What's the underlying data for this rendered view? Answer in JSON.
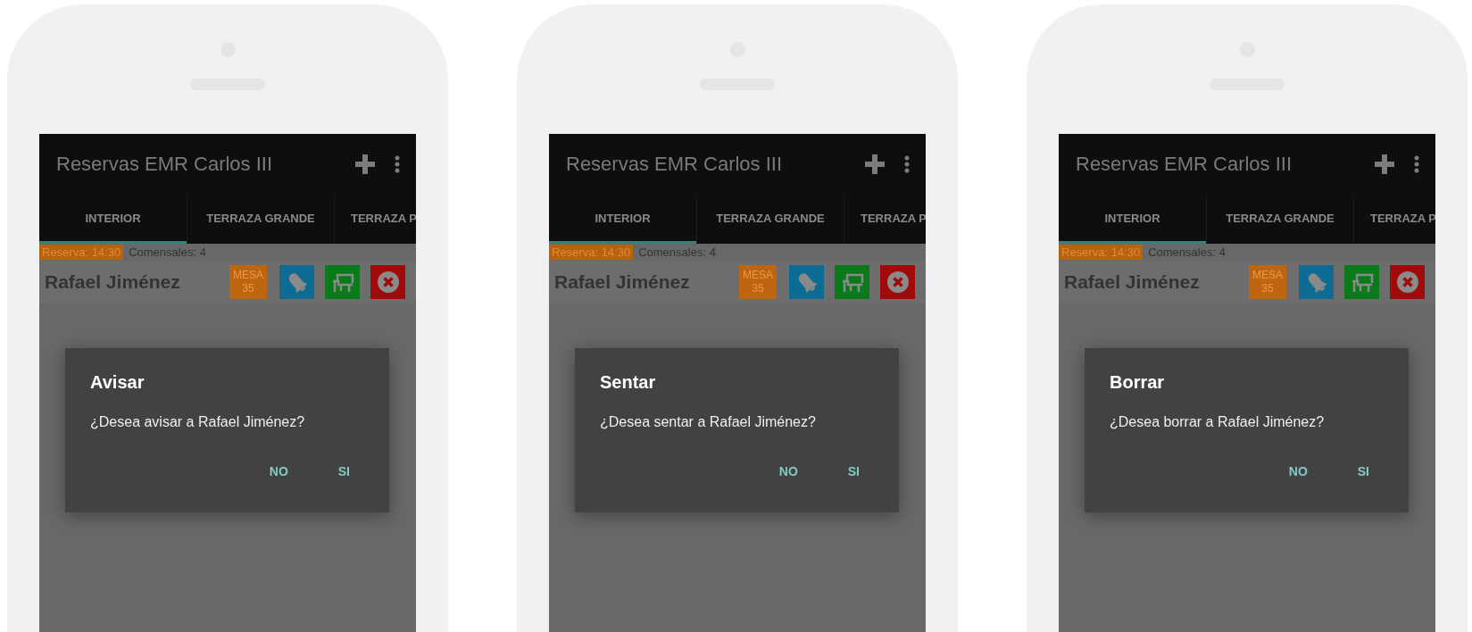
{
  "phones": [
    {
      "app_bar": {
        "title": "Reservas EMR Carlos III"
      },
      "tabs": [
        {
          "label": "INTERIOR",
          "selected": true
        },
        {
          "label": "TERRAZA GRANDE",
          "selected": false
        },
        {
          "label": "TERRAZA P",
          "selected": false
        }
      ],
      "reservation": {
        "time": "Reserva: 14:30",
        "guests": "Comensales: 4",
        "name": "Rafael Jiménez",
        "table_label": "MESA",
        "table_number": "35"
      },
      "dialog": {
        "title": "Avisar",
        "message": "¿Desea avisar a Rafael Jiménez?",
        "buttons": [
          "NO",
          "SI"
        ]
      }
    },
    {
      "app_bar": {
        "title": "Reservas EMR Carlos III"
      },
      "tabs": [
        {
          "label": "INTERIOR",
          "selected": true
        },
        {
          "label": "TERRAZA GRANDE",
          "selected": false
        },
        {
          "label": "TERRAZA P",
          "selected": false
        }
      ],
      "reservation": {
        "time": "Reserva: 14:30",
        "guests": "Comensales: 4",
        "name": "Rafael Jiménez",
        "table_label": "MESA",
        "table_number": "35"
      },
      "dialog": {
        "title": "Sentar",
        "message": "¿Desea sentar a Rafael Jiménez?",
        "buttons": [
          "NO",
          "SI"
        ]
      }
    },
    {
      "app_bar": {
        "title": "Reservas EMR Carlos III"
      },
      "tabs": [
        {
          "label": "INTERIOR",
          "selected": true
        },
        {
          "label": "TERRAZA GRANDE",
          "selected": false
        },
        {
          "label": "TERRAZA P",
          "selected": false
        }
      ],
      "reservation": {
        "time": "Reserva: 14:30",
        "guests": "Comensales: 4",
        "name": "Rafael Jiménez",
        "table_label": "MESA",
        "table_number": "35"
      },
      "dialog": {
        "title": "Borrar",
        "message": "¿Desea borrar a Rafael Jiménez?",
        "buttons": [
          "NO",
          "SI"
        ]
      }
    }
  ]
}
